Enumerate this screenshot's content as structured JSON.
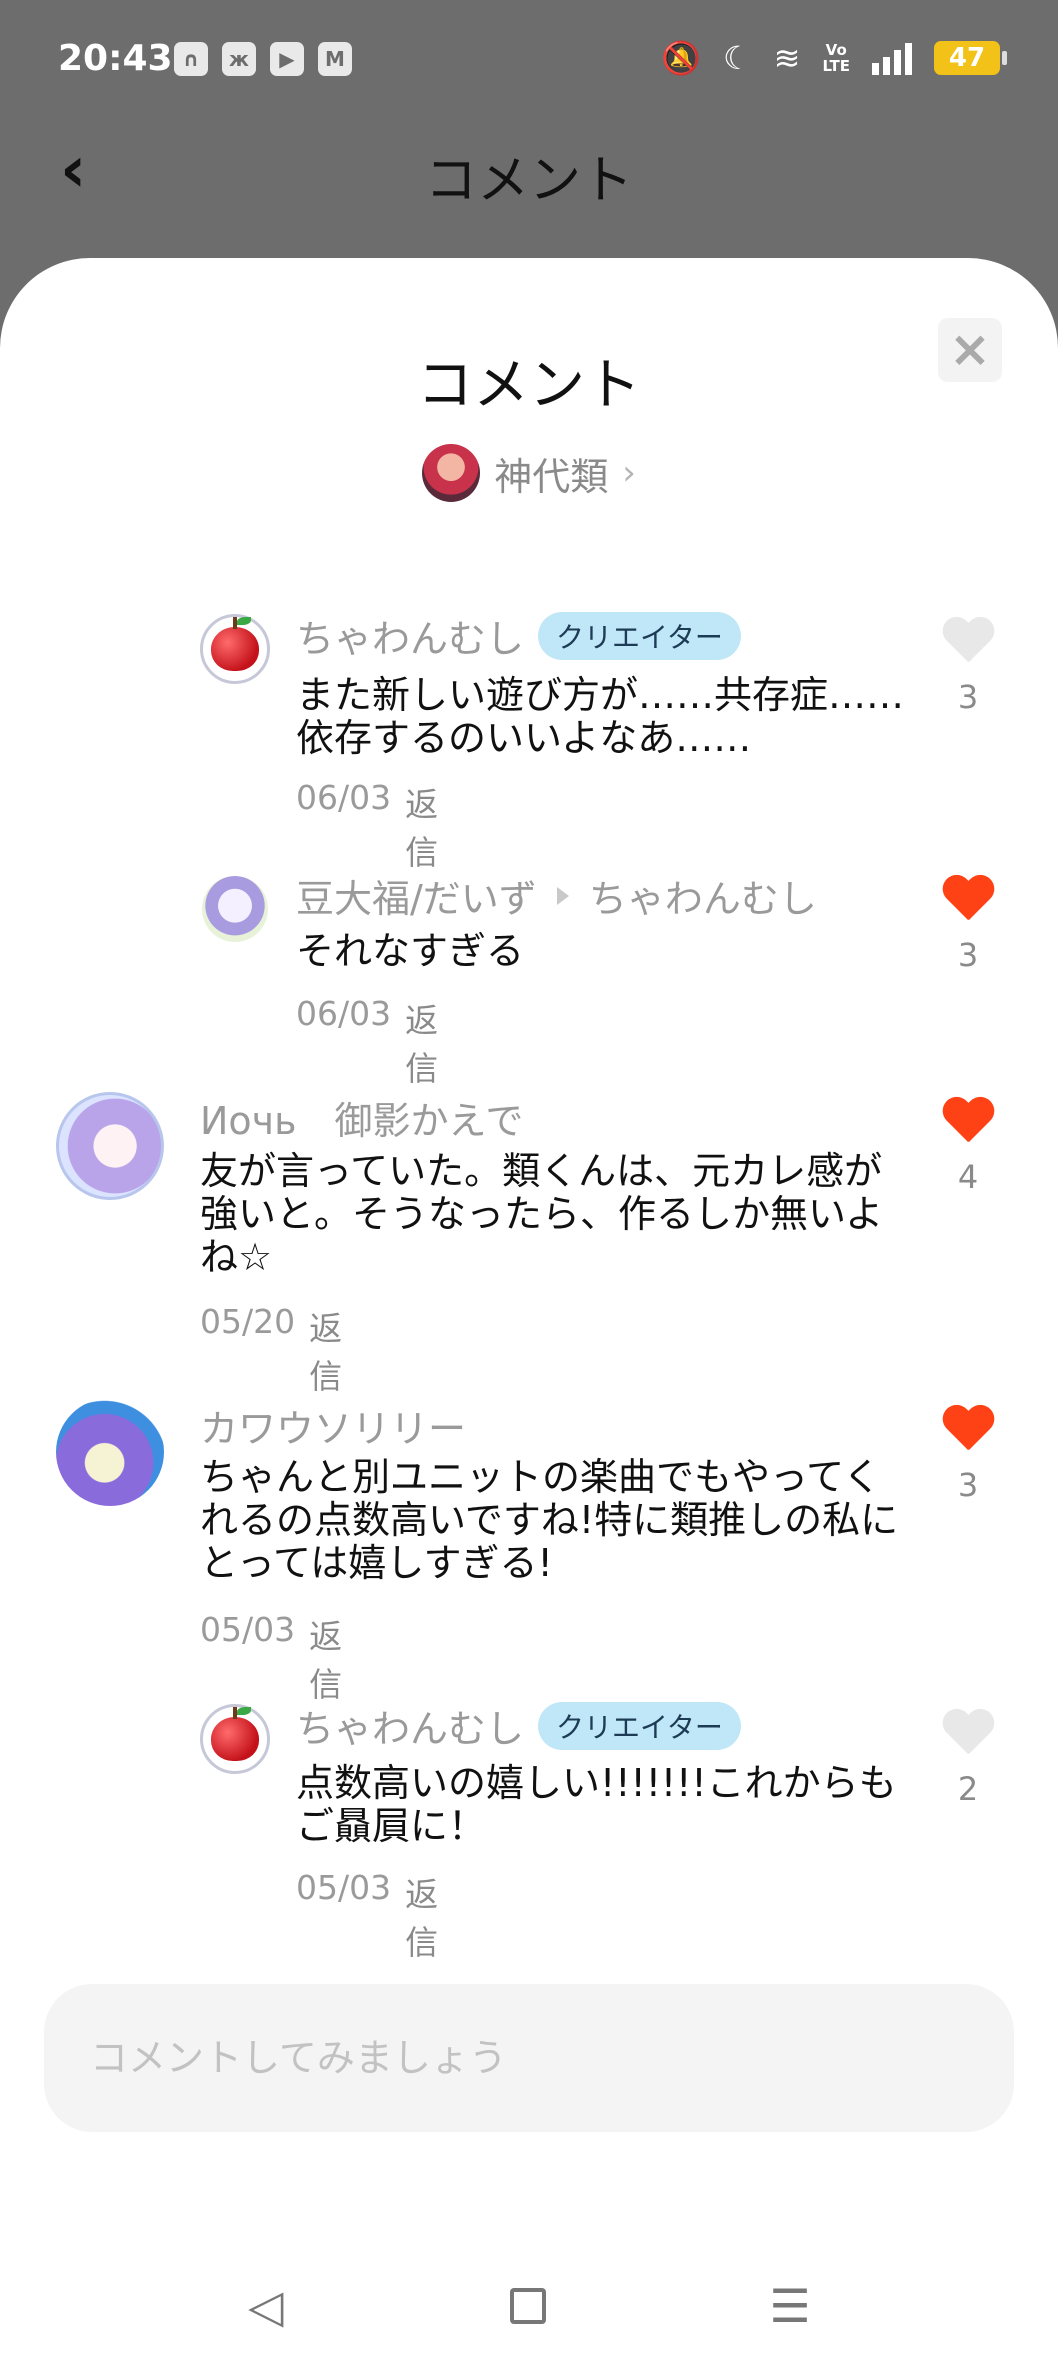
{
  "status_bar": {
    "time": "20:43",
    "left_icons": [
      "notification-app-icon",
      "butterfly-icon",
      "youtube-icon",
      "gmail-icon"
    ],
    "right_icons": [
      "mute-icon",
      "moon-icon",
      "wifi-icon",
      "volte-icon",
      "signal-icon"
    ],
    "volte": "Vo\nLTE",
    "battery": "47"
  },
  "topbar": {
    "title": "コメント"
  },
  "sheet": {
    "title": "コメント",
    "author": "神代類"
  },
  "comments": [
    {
      "name": "ちゃわんむし",
      "badge": "クリエイター",
      "text": "また新しい遊び方が……共存症……依存するのいいよなあ……",
      "date": "06/03",
      "reply": "返信",
      "likes": "3",
      "liked": false
    },
    {
      "name": "豆大福/だいず",
      "reply_to": "ちゃわんむし",
      "text": "それなすぎる",
      "date": "06/03",
      "reply": "返信",
      "likes": "3",
      "liked": true
    },
    {
      "name": "Иочь　御影かえで",
      "text": "友が言っていた。類くんは、元カレ感が強いと。そうなったら、作るしか無いよね☆",
      "date": "05/20",
      "reply": "返信",
      "likes": "4",
      "liked": true
    },
    {
      "name": "カワウソリリー",
      "text": "ちゃんと別ユニットの楽曲でもやってくれるの点数高いですね!特に類推しの私にとっては嬉しすぎる!",
      "date": "05/03",
      "reply": "返信",
      "likes": "3",
      "liked": true
    },
    {
      "name": "ちゃわんむし",
      "badge": "クリエイター",
      "text": "点数高いの嬉しい!!!!!!!これからもご贔屓に！",
      "date": "05/03",
      "reply": "返信",
      "likes": "2",
      "liked": false
    }
  ],
  "input": {
    "placeholder": "コメントしてみましょう"
  },
  "navbar": {
    "back": "◁",
    "home": "",
    "menu": "☰"
  },
  "colors": {
    "like_active": "#ff4216",
    "badge_bg": "#bfe7f8"
  }
}
